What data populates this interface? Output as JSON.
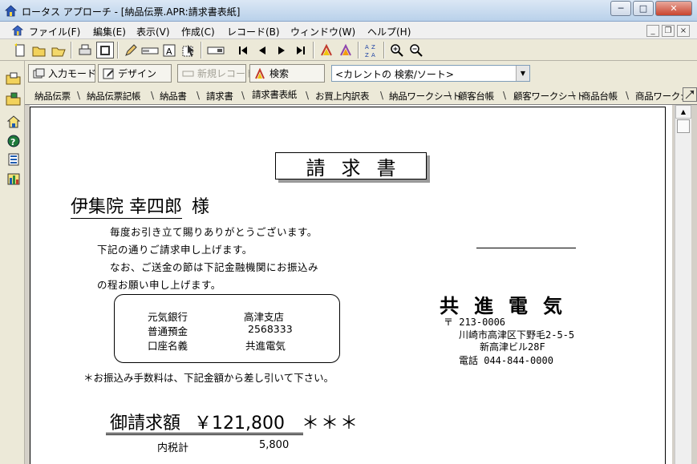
{
  "window": {
    "title": "ロータス アプローチ - [納品伝票.APR:請求書表紙]",
    "min_label": "─",
    "max_label": "□",
    "close_label": "✕"
  },
  "menu": {
    "items": [
      "ファイル(F)",
      "編集(E)",
      "表示(V)",
      "作成(C)",
      "レコード(B)",
      "ウィンドウ(W)",
      "ヘルプ(H)"
    ],
    "mdi_min": "_",
    "mdi_restore": "❐",
    "mdi_close": "×"
  },
  "toolbar2": {
    "input_mode": "入力モード",
    "design": "デザイン",
    "new_record": "新規レコード",
    "search": "検索",
    "search_combo": "<カレントの 検索/ソート>"
  },
  "tabs": [
    "納品伝票",
    "納品伝票記帳",
    "納品書",
    "請求書",
    "請求書表紙",
    "お買上内訳表",
    "納品ワークシート",
    "顧客台帳",
    "顧客ワークシート",
    "商品台帳",
    "商品ワークシ"
  ],
  "active_tab_index": 4,
  "document": {
    "title": "請求書",
    "customer_name": "伊集院 幸四郎",
    "customer_suffix": "様",
    "greeting": [
      "毎度お引き立て賜りありがとうございます。",
      "下記の通りご請求申し上げます。",
      "なお、ご送金の節は下記金融機関にお振込み",
      "の程お願い申し上げます。"
    ],
    "bank": {
      "row1": [
        "元気銀行",
        "高津支店"
      ],
      "row2": [
        "普通預金",
        "2568333"
      ],
      "row3": [
        "口座名義",
        "共進電気"
      ]
    },
    "fee_note": "＊お振込み手数料は、下記金額から差し引いて下さい。",
    "company": {
      "name": "共進電気",
      "postal": "〒 213-0006",
      "address1": "川崎市高津区下野毛2-5-5",
      "address2": "新高津ビル28F",
      "phone": "電話 044-844-0000"
    },
    "total": {
      "label": "御請求額",
      "amount": "￥121,800",
      "stars": "＊＊＊"
    },
    "tax": {
      "label": "内税計",
      "value": "5,800"
    }
  }
}
